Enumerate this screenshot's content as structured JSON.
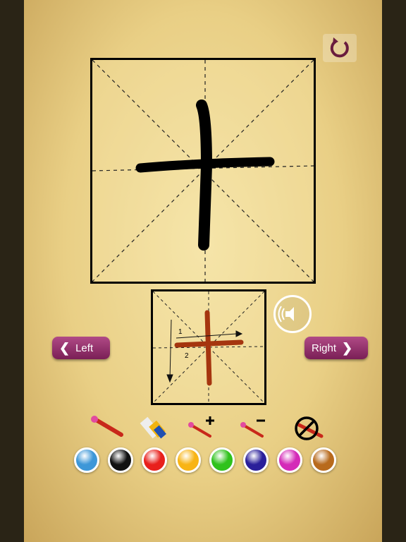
{
  "nav": {
    "left_label": "Left",
    "right_label": "Right"
  },
  "icons": {
    "reset": "refresh-icon",
    "sound": "speaker-icon",
    "brush": "brush-icon",
    "eraser": "eraser-icon",
    "brush_larger": "brush-plus-icon",
    "brush_smaller": "brush-minus-icon",
    "clear": "no-brush-icon"
  },
  "example": {
    "stroke_numbers": [
      "1",
      "2"
    ]
  },
  "colors": [
    "#3d97d8",
    "#111111",
    "#e8201c",
    "#f8b415",
    "#2fc21c",
    "#2a1f9a",
    "#d42ab8",
    "#b86a1c"
  ],
  "ink_color": "#000000",
  "example_color": "#a5350f"
}
